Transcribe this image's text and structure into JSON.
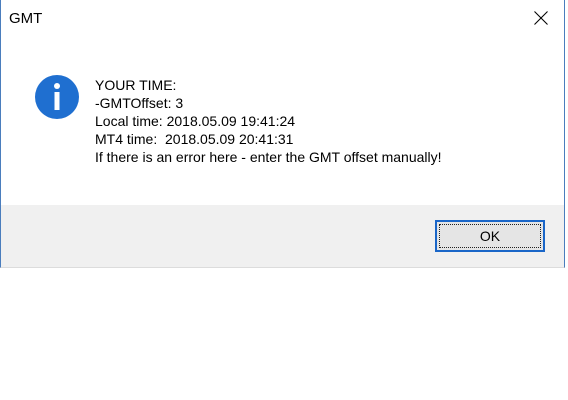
{
  "window": {
    "title": "GMT"
  },
  "message": {
    "lines": [
      "YOUR TIME:",
      "-GMTOffset: 3",
      "Local time: 2018.05.09 19:41:24",
      "MT4 time:  2018.05.09 20:41:31",
      "If there is an error here - enter the GMT offset manually!"
    ],
    "icon": "info-icon"
  },
  "buttons": {
    "ok_label": "OK"
  },
  "colors": {
    "icon_blue": "#1f6fd0",
    "focus_border": "#1a66c8",
    "footer_bg": "#f0f0f0"
  }
}
